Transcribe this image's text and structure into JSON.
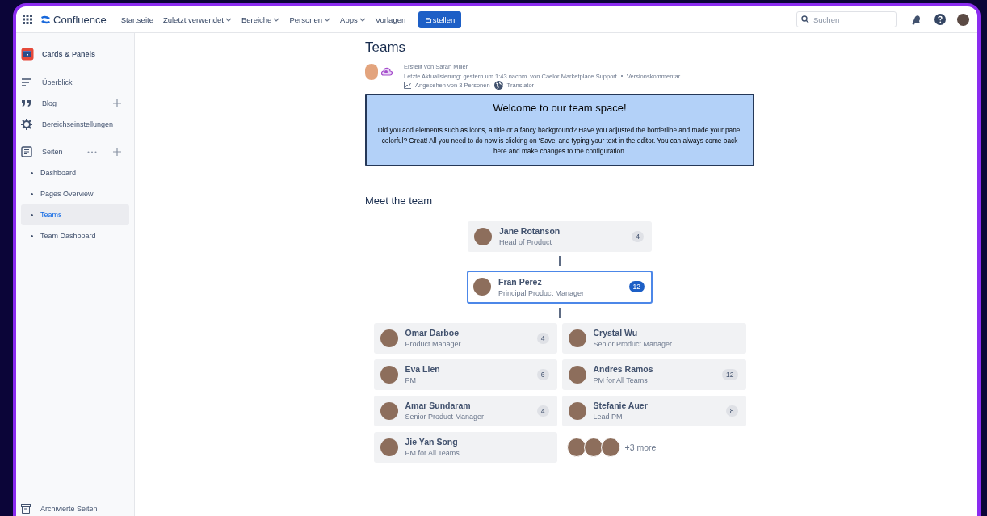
{
  "topbar": {
    "app_name": "Confluence",
    "nav": [
      {
        "label": "Startseite",
        "dropdown": false
      },
      {
        "label": "Zuletzt verwendet",
        "dropdown": true
      },
      {
        "label": "Bereiche",
        "dropdown": true
      },
      {
        "label": "Personen",
        "dropdown": true
      },
      {
        "label": "Apps",
        "dropdown": true
      },
      {
        "label": "Vorlagen",
        "dropdown": false
      }
    ],
    "create_button": "Erstellen",
    "search": {
      "placeholder": "Suchen"
    }
  },
  "sidebar": {
    "space_name": "Cards & Panels",
    "items": [
      {
        "label": "Überblick",
        "kind": "overview",
        "add": false
      },
      {
        "label": "Blog",
        "kind": "blog",
        "add": true
      },
      {
        "label": "Bereichseinstellungen",
        "kind": "settings",
        "add": false
      }
    ],
    "pages_label": "Seiten",
    "pages": [
      {
        "label": "Dashboard",
        "selected": false
      },
      {
        "label": "Pages Overview",
        "selected": false
      },
      {
        "label": "Teams",
        "selected": true
      },
      {
        "label": "Team Dashboard",
        "selected": false
      }
    ],
    "footer": "Archivierte Seiten"
  },
  "page": {
    "title": "Teams",
    "byline": {
      "created": "Erstellt von Sarah Miller",
      "updated": "Letzte Aktualisierung: gestern um 1:43 nachm. von Caelor Marketplace Support",
      "version_link": "Versionskommentar",
      "views": "Angesehen von 3 Personen",
      "translator": "Translator"
    },
    "panel": {
      "title": "Welcome to our team space!",
      "body": "Did you add elements such as icons, a title or a fancy background? Have you adjusted the borderline and made your panel colorful? Great! All you need to do now is clicking on ‘Save’ and typing your text in the editor. You can always come back here and make changes to the configuration."
    },
    "section_heading": "Meet the team",
    "org_chart": {
      "head": {
        "name": "Jane Rotanson",
        "role": "Head of Product",
        "count": "4",
        "selected": false
      },
      "manager": {
        "name": "Fran Perez",
        "role": "Principal Product Manager",
        "count": "12",
        "selected": true
      },
      "reports": [
        {
          "kind": "person",
          "name": "Omar Darboe",
          "role": "Product Manager",
          "count": "4",
          "selected": false
        },
        {
          "kind": "person",
          "name": "Crystal Wu",
          "role": "Senior Product Manager",
          "selected": false
        },
        {
          "kind": "person",
          "name": "Eva Lien",
          "role": "PM",
          "count": "6",
          "selected": false
        },
        {
          "kind": "person",
          "name": "Andres Ramos",
          "role": "PM for All Teams",
          "count": "12",
          "selected": false
        },
        {
          "kind": "person",
          "name": "Amar Sundaram",
          "role": "Senior Product Manager",
          "count": "4",
          "selected": false
        },
        {
          "kind": "person",
          "name": "Stefanie Auer",
          "role": "Lead PM",
          "count": "8",
          "selected": false
        },
        {
          "kind": "person",
          "name": "Jie Yan Song",
          "role": "PM for All Teams",
          "selected": false
        },
        {
          "kind": "more",
          "label": "+3 more"
        }
      ]
    }
  }
}
